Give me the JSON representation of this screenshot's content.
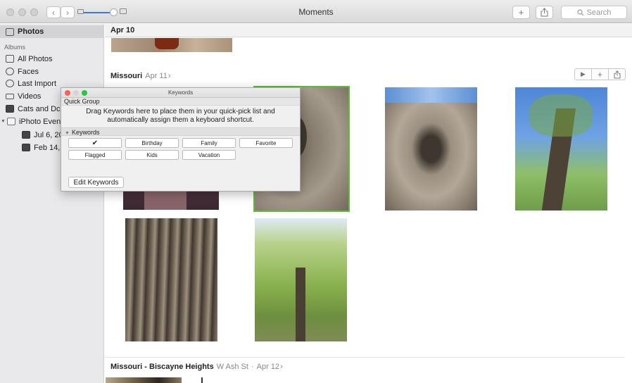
{
  "window": {
    "title": "Moments",
    "nav_back": "‹",
    "nav_forward": "›",
    "add_label": "+",
    "share_label": "⇪",
    "search_placeholder": "Search",
    "search_icon": "magnifier-icon"
  },
  "sidebar": {
    "photos_label": "Photos",
    "albums_label": "Albums",
    "items": [
      {
        "label": "All Photos",
        "icon": "grid-icon"
      },
      {
        "label": "Faces",
        "icon": "face-icon"
      },
      {
        "label": "Last Import",
        "icon": "clock-icon"
      },
      {
        "label": "Videos",
        "icon": "film-icon"
      },
      {
        "label": "Cats and Dc",
        "icon": "album-icon"
      },
      {
        "label": "iPhoto Even",
        "icon": "folder-icon"
      },
      {
        "label": "Jul 6, 20",
        "icon": "event-icon"
      },
      {
        "label": "Feb 14, 2",
        "icon": "event-icon"
      }
    ]
  },
  "main": {
    "date_header": "Apr 10",
    "moment1": {
      "place": "Missouri",
      "date": "Apr 11",
      "chevron": "›"
    },
    "moment2": {
      "place": "Missouri - Biscayne Heights",
      "sub": "W Ash St",
      "dot": "·",
      "date": "Apr 12",
      "chevron": "›"
    },
    "actions": {
      "play": "▶",
      "add": "+",
      "share": "⇪"
    }
  },
  "keywords_panel": {
    "title": "Keywords",
    "quick_group": "Quick Group",
    "help_line1": "Drag Keywords here to place them in your quick-pick list and",
    "help_line2": "automatically assign them a keyboard shortcut.",
    "section_label": "Keywords",
    "disclosure": "▼",
    "keywords": [
      "✔",
      "Birthday",
      "Family",
      "Favorite",
      "Flagged",
      "Kids",
      "Vacation",
      ""
    ],
    "edit_button": "Edit Keywords"
  },
  "colors": {
    "accent_blue": "#3a7bd5",
    "selection_green": "#5cbd3a",
    "close_red": "#fd5f57",
    "minimize_yellow": "#febc2e",
    "zoom_green": "#28c840"
  }
}
